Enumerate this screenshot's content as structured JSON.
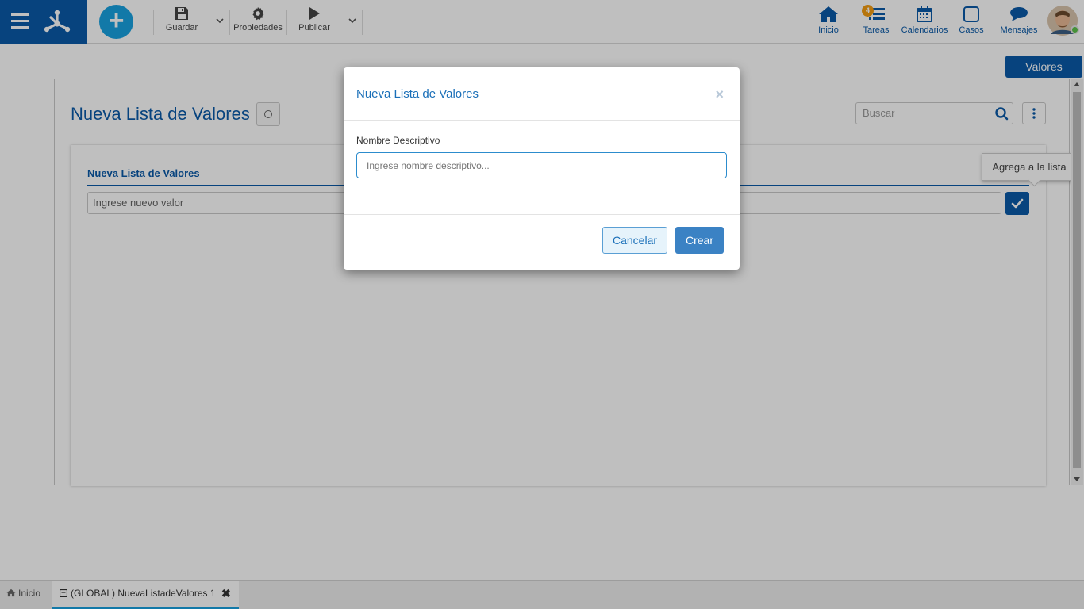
{
  "toolbar": {
    "guardar_label": "Guardar",
    "propiedades_label": "Propiedades",
    "publicar_label": "Publicar"
  },
  "nav": {
    "inicio": "Inicio",
    "tareas": "Tareas",
    "tareas_badge": "4",
    "calendarios": "Calendarios",
    "casos": "Casos",
    "mensajes": "Mensajes"
  },
  "page": {
    "valores_tab": "Valores",
    "title": "Nueva Lista de Valores",
    "search_placeholder": "Buscar",
    "section_title": "Nueva Lista de Valores",
    "value_placeholder": "Ingrese nuevo valor",
    "tooltip": "Agrega a la lista"
  },
  "modal": {
    "title": "Nueva Lista de Valores",
    "close": "×",
    "field_label": "Nombre Descriptivo",
    "field_placeholder": "Ingrese nombre descriptivo...",
    "cancel_label": "Cancelar",
    "create_label": "Crear"
  },
  "bottom_tabs": [
    {
      "label": "Inicio"
    },
    {
      "label": "(GLOBAL) NuevaListadeValores 1"
    }
  ],
  "colors": {
    "brand_blue": "#0a5aa8",
    "accent_cyan": "#19a2e0",
    "badge_orange": "#f39c12"
  }
}
